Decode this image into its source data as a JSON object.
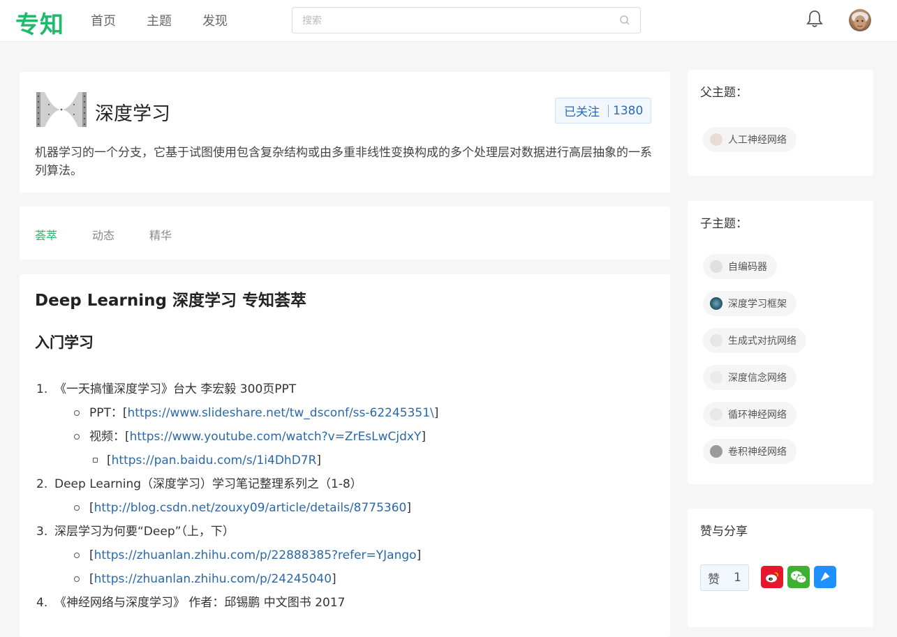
{
  "header": {
    "logo": "专知",
    "nav": [
      "首页",
      "主题",
      "发现"
    ],
    "search_placeholder": "搜索"
  },
  "topic": {
    "title": "深度学习",
    "follow_label": "已关注",
    "follow_count": "1380",
    "description": "机器学习的一个分支，它基于试图使用包含复杂结构或由多重非线性变换构成的多个处理层对数据进行高层抽象的一系列算法。"
  },
  "tabs": [
    "荟萃",
    "动态",
    "精华"
  ],
  "content": {
    "title": "Deep Learning 深度学习 专知荟萃",
    "section": "入门学习",
    "items": [
      {
        "num": "1.",
        "text": "《一天搞懂深度学习》台大 李宏毅 300页PPT"
      },
      {
        "prefix": "PPT：[",
        "link": "https://www.slideshare.net/tw_dsconf/ss-62245351\\",
        "suffix": "]"
      },
      {
        "prefix": "视频：[",
        "link": "https://www.youtube.com/watch?v=ZrEsLwCjdxY",
        "suffix": "]"
      },
      {
        "prefix": "[",
        "link": "https://pan.baidu.com/s/1i4DhD7R",
        "suffix": "]"
      },
      {
        "num": "2.",
        "text": "Deep Learning（深度学习）学习笔记整理系列之（1-8）"
      },
      {
        "prefix": "[",
        "link": "http://blog.csdn.net/zouxy09/article/details/8775360",
        "suffix": "]"
      },
      {
        "num": "3.",
        "text": "深层学习为何要“Deep”（上，下）"
      },
      {
        "prefix": "[",
        "link": "https://zhuanlan.zhihu.com/p/22888385?refer=YJango",
        "suffix": "]"
      },
      {
        "prefix": "[",
        "link": "https://zhuanlan.zhihu.com/p/24245040",
        "suffix": "]"
      },
      {
        "num": "4.",
        "text": "《神经网络与深度学习》 作者：邱锡鹏 中文图书 2017"
      }
    ]
  },
  "sidebar": {
    "parent_title": "父主题：",
    "parent_topics": [
      "人工神经网络"
    ],
    "child_title": "子主题：",
    "child_topics": [
      "自编码器",
      "深度学习框架",
      "生成式对抗网络",
      "深度信念网络",
      "循环神经网络",
      "卷积神经网络"
    ],
    "share_title": "赞与分享",
    "like_label": "赞",
    "like_count": "1"
  },
  "colors": {
    "brand": "#1fba6a",
    "link": "#2b68a8",
    "weibo": "#e6162d",
    "wechat": "#3eb135",
    "qzone": "#1e90ff"
  }
}
